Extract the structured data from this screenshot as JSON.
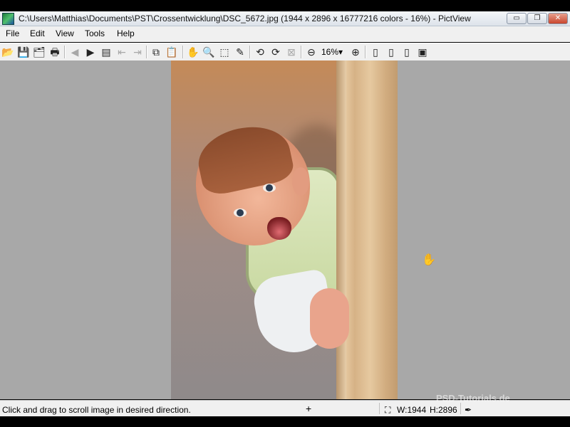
{
  "window": {
    "title": "C:\\Users\\Matthias\\Documents\\PST\\Crossentwicklung\\DSC_5672.jpg (1944 x 2896 x 16777216 colors - 16%) - PictView",
    "controls": {
      "minimize": "▭",
      "maximize": "❐",
      "close": "✕"
    }
  },
  "menu": [
    "File",
    "Edit",
    "View",
    "Tools",
    "Help"
  ],
  "toolbar": {
    "zoom": "16%",
    "zoom_caret": "▾"
  },
  "icons": {
    "open": "📂",
    "save": "💾",
    "properties": "🗂",
    "print": "🖶",
    "prev": "◀",
    "next": "▶",
    "page": "▤",
    "page_prev": "⇤",
    "page_next": "⇥",
    "copy": "⧉",
    "paste": "📋",
    "hand": "✋",
    "zoom": "🔍",
    "select": "⬚",
    "eyedropper": "✎",
    "rotate_left": "⟲",
    "rotate_right": "⟳",
    "crop": "⊠",
    "zoom_out": "⊖",
    "zoom_in": "⊕",
    "fit1": "▯",
    "fit2": "▯",
    "fit3": "▯",
    "fit4": "▣",
    "dims": "⛶",
    "plus": "+",
    "cursor": "✋",
    "pipette": "✒"
  },
  "statusbar": {
    "hint": "Click and drag to scroll image in desired direction.",
    "width": "W:1944",
    "height": "H:2896"
  },
  "watermark": "PSD-Tutorials.de"
}
